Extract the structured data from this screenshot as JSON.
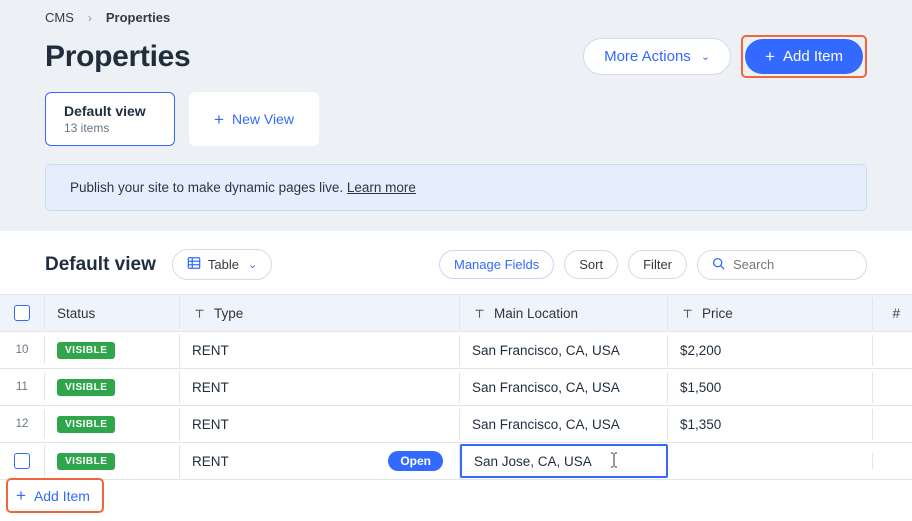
{
  "breadcrumb": {
    "root": "CMS",
    "current": "Properties"
  },
  "header": {
    "title": "Properties",
    "more_actions": "More Actions",
    "add_item": "Add Item"
  },
  "views": {
    "default": {
      "name": "Default view",
      "count": "13 items"
    },
    "new_view": "New View"
  },
  "banner": {
    "text": "Publish your site to make dynamic pages live. ",
    "link": "Learn more"
  },
  "controls": {
    "view_name": "Default view",
    "table_label": "Table",
    "manage_fields": "Manage Fields",
    "sort": "Sort",
    "filter": "Filter",
    "search_placeholder": "Search"
  },
  "columns": {
    "status": "Status",
    "type": "Type",
    "main_location": "Main Location",
    "price": "Price",
    "hash": "#"
  },
  "rows": [
    {
      "num": "10",
      "status": "VISIBLE",
      "type": "RENT",
      "location": "San Francisco, CA, USA",
      "price": "$2,200"
    },
    {
      "num": "11",
      "status": "VISIBLE",
      "type": "RENT",
      "location": "San Francisco, CA, USA",
      "price": "$1,500"
    },
    {
      "num": "12",
      "status": "VISIBLE",
      "type": "RENT",
      "location": "San Francisco, CA, USA",
      "price": "$1,350"
    }
  ],
  "editing_row": {
    "status": "VISIBLE",
    "type": "RENT",
    "open": "Open",
    "location": "San Jose, CA, USA",
    "price": ""
  },
  "footer": {
    "add_item": "Add Item"
  }
}
